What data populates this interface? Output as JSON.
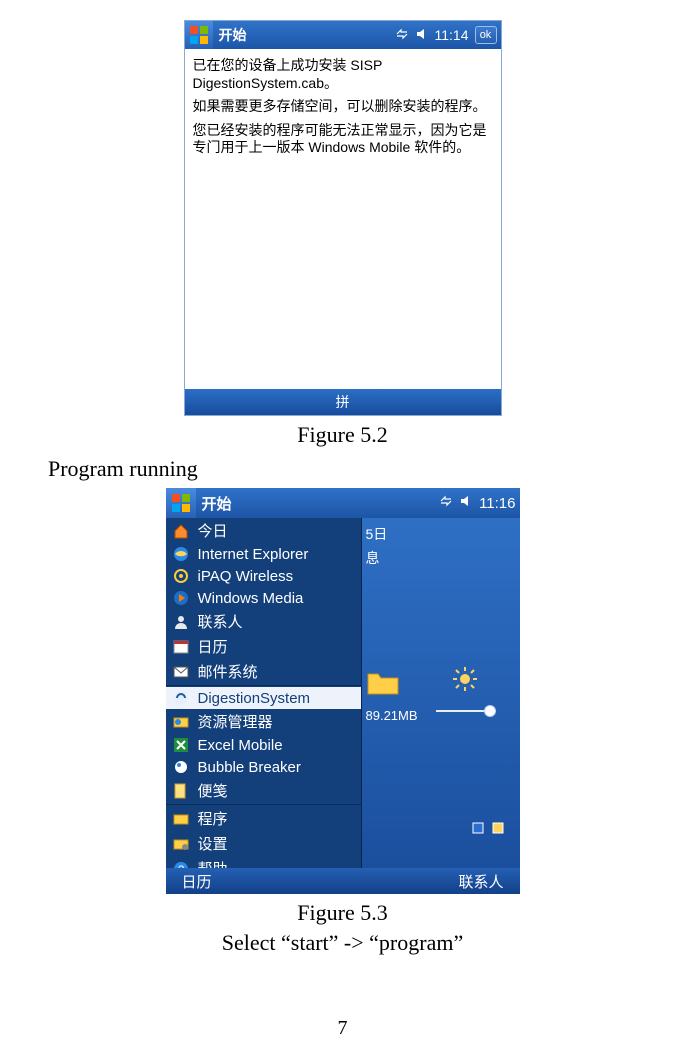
{
  "fig52": {
    "topbar": {
      "title": "开始",
      "time": "11:14",
      "ok": "ok"
    },
    "body": {
      "p1": "已在您的设备上成功安装 SISP DigestionSystem.cab。",
      "p2": "如果需要更多存储空间，可以删除安装的程序。",
      "p3": "您已经安装的程序可能无法正常显示，因为它是专门用于上一版本 Windows Mobile 软件的。"
    },
    "bottom": "拼",
    "caption": "Figure 5.2"
  },
  "section_heading": "Program running",
  "fig53": {
    "topbar": {
      "title": "开始",
      "time": "11:16"
    },
    "desktop": {
      "line1": "5日",
      "line2": "息",
      "mb": "89.21MB"
    },
    "menu": {
      "items": [
        {
          "name": "today",
          "label": "今日"
        },
        {
          "name": "ie",
          "label": "Internet Explorer"
        },
        {
          "name": "ipaq",
          "label": "iPAQ Wireless"
        },
        {
          "name": "wmp",
          "label": "Windows Media"
        },
        {
          "name": "contacts",
          "label": "联系人"
        },
        {
          "name": "calendar",
          "label": "日历"
        },
        {
          "name": "mail",
          "label": "邮件系统"
        },
        {
          "name": "digestion",
          "label": "DigestionSystem"
        },
        {
          "name": "resmgr",
          "label": "资源管理器"
        },
        {
          "name": "excel",
          "label": "Excel Mobile"
        },
        {
          "name": "bubble",
          "label": "Bubble Breaker"
        },
        {
          "name": "notes",
          "label": "便笺"
        },
        {
          "name": "programs",
          "label": "程序"
        },
        {
          "name": "settings",
          "label": "设置"
        },
        {
          "name": "help",
          "label": "帮助"
        }
      ]
    },
    "bottom": {
      "left": "日历",
      "right": "联系人"
    },
    "caption": "Figure 5.3",
    "subcaption": "Select “start” -> “program”"
  },
  "page_number": "7"
}
